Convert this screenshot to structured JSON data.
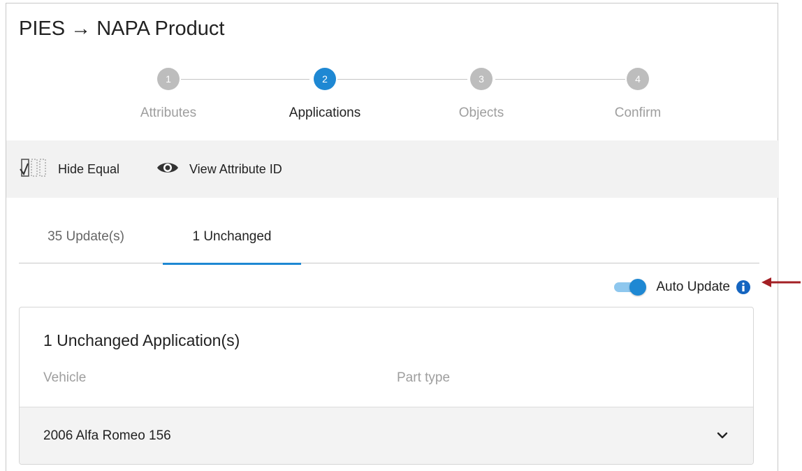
{
  "header": {
    "title": "PIES → NAPA Product"
  },
  "stepper": {
    "steps": [
      {
        "number": "1",
        "label": "Attributes",
        "active": false
      },
      {
        "number": "2",
        "label": "Applications",
        "active": true
      },
      {
        "number": "3",
        "label": "Objects",
        "active": false
      },
      {
        "number": "4",
        "label": "Confirm",
        "active": false
      }
    ]
  },
  "toolbar": {
    "hide_equal": {
      "label": "Hide Equal",
      "icon": "checklist-icon"
    },
    "view_attribute_id": {
      "label": "View Attribute ID",
      "icon": "eye-icon"
    }
  },
  "tabs": [
    {
      "label": "35 Update(s)",
      "active": false
    },
    {
      "label": "1 Unchanged",
      "active": true
    }
  ],
  "auto_update": {
    "label": "Auto Update",
    "enabled": true,
    "icon": "info-icon"
  },
  "card": {
    "title": "1 Unchanged Application(s)",
    "columns": [
      "Vehicle",
      "Part type"
    ],
    "rows": [
      {
        "vehicle": "2006 Alfa Romeo 156",
        "icon": "chevron-down-icon"
      }
    ]
  },
  "colors": {
    "accent": "#1e88d3",
    "inactive_step": "#bdbdbd",
    "annotation_arrow": "#a31f24",
    "toolbar_bg": "#f2f2f2"
  }
}
